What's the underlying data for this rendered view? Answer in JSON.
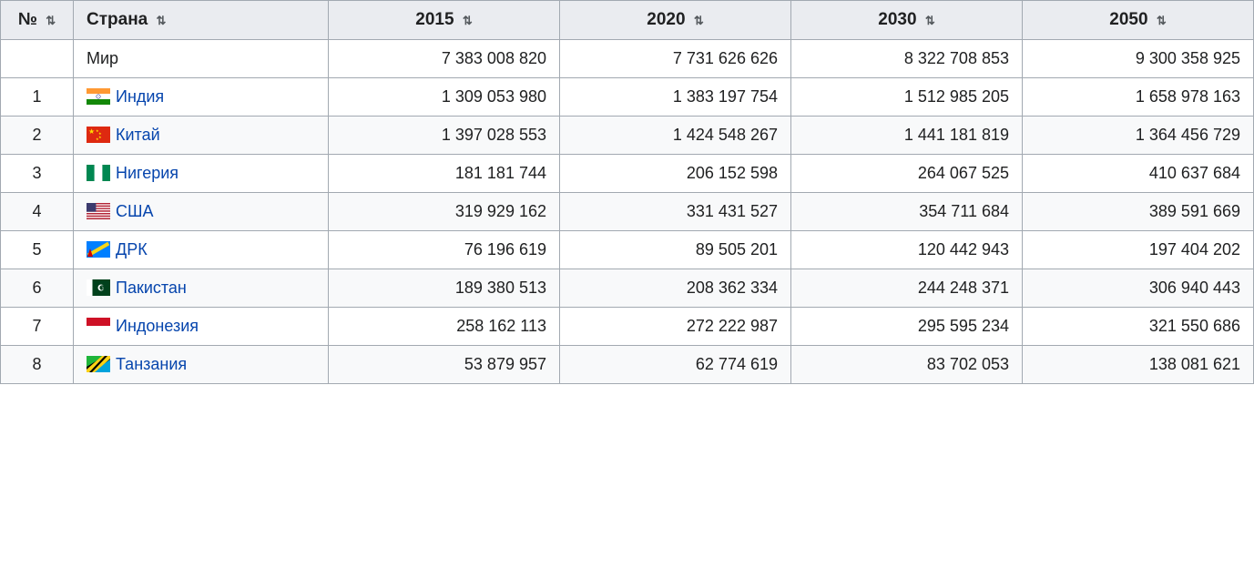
{
  "table": {
    "headers": [
      {
        "key": "num",
        "label": "№",
        "sortable": true
      },
      {
        "key": "country",
        "label": "Страна",
        "sortable": true
      },
      {
        "key": "y2015",
        "label": "2015",
        "sortable": true
      },
      {
        "key": "y2020",
        "label": "2020",
        "sortable": true
      },
      {
        "key": "y2030",
        "label": "2030",
        "sortable": true
      },
      {
        "key": "y2050",
        "label": "2050",
        "sortable": true
      }
    ],
    "world_row": {
      "num": "",
      "country": "Мир",
      "flag": null,
      "y2015": "7 383 008 820",
      "y2020": "7 731 626 626",
      "y2030": "8 322 708 853",
      "y2050": "9 300 358 925"
    },
    "rows": [
      {
        "num": "1",
        "country": "Индия",
        "flag": "india",
        "y2015": "1 309 053 980",
        "y2020": "1 383 197 754",
        "y2030": "1 512 985 205",
        "y2050": "1 658 978 163"
      },
      {
        "num": "2",
        "country": "Китай",
        "flag": "china",
        "y2015": "1 397 028 553",
        "y2020": "1 424 548 267",
        "y2030": "1 441 181 819",
        "y2050": "1 364 456 729"
      },
      {
        "num": "3",
        "country": "Нигерия",
        "flag": "nigeria",
        "y2015": "181 181 744",
        "y2020": "206 152 598",
        "y2030": "264 067 525",
        "y2050": "410 637 684"
      },
      {
        "num": "4",
        "country": "США",
        "flag": "usa",
        "y2015": "319 929 162",
        "y2020": "331 431 527",
        "y2030": "354 711 684",
        "y2050": "389 591 669"
      },
      {
        "num": "5",
        "country": "ДРК",
        "flag": "drc",
        "y2015": "76 196 619",
        "y2020": "89 505 201",
        "y2030": "120 442 943",
        "y2050": "197 404 202"
      },
      {
        "num": "6",
        "country": "Пакистан",
        "flag": "pakistan",
        "y2015": "189 380 513",
        "y2020": "208 362 334",
        "y2030": "244 248 371",
        "y2050": "306 940 443"
      },
      {
        "num": "7",
        "country": "Индонезия",
        "flag": "indonesia",
        "y2015": "258 162 113",
        "y2020": "272 222 987",
        "y2030": "295 595 234",
        "y2050": "321 550 686"
      },
      {
        "num": "8",
        "country": "Танзания",
        "flag": "tanzania",
        "y2015": "53 879 957",
        "y2020": "62 774 619",
        "y2030": "83 702 053",
        "y2050": "138 081 621"
      }
    ]
  }
}
